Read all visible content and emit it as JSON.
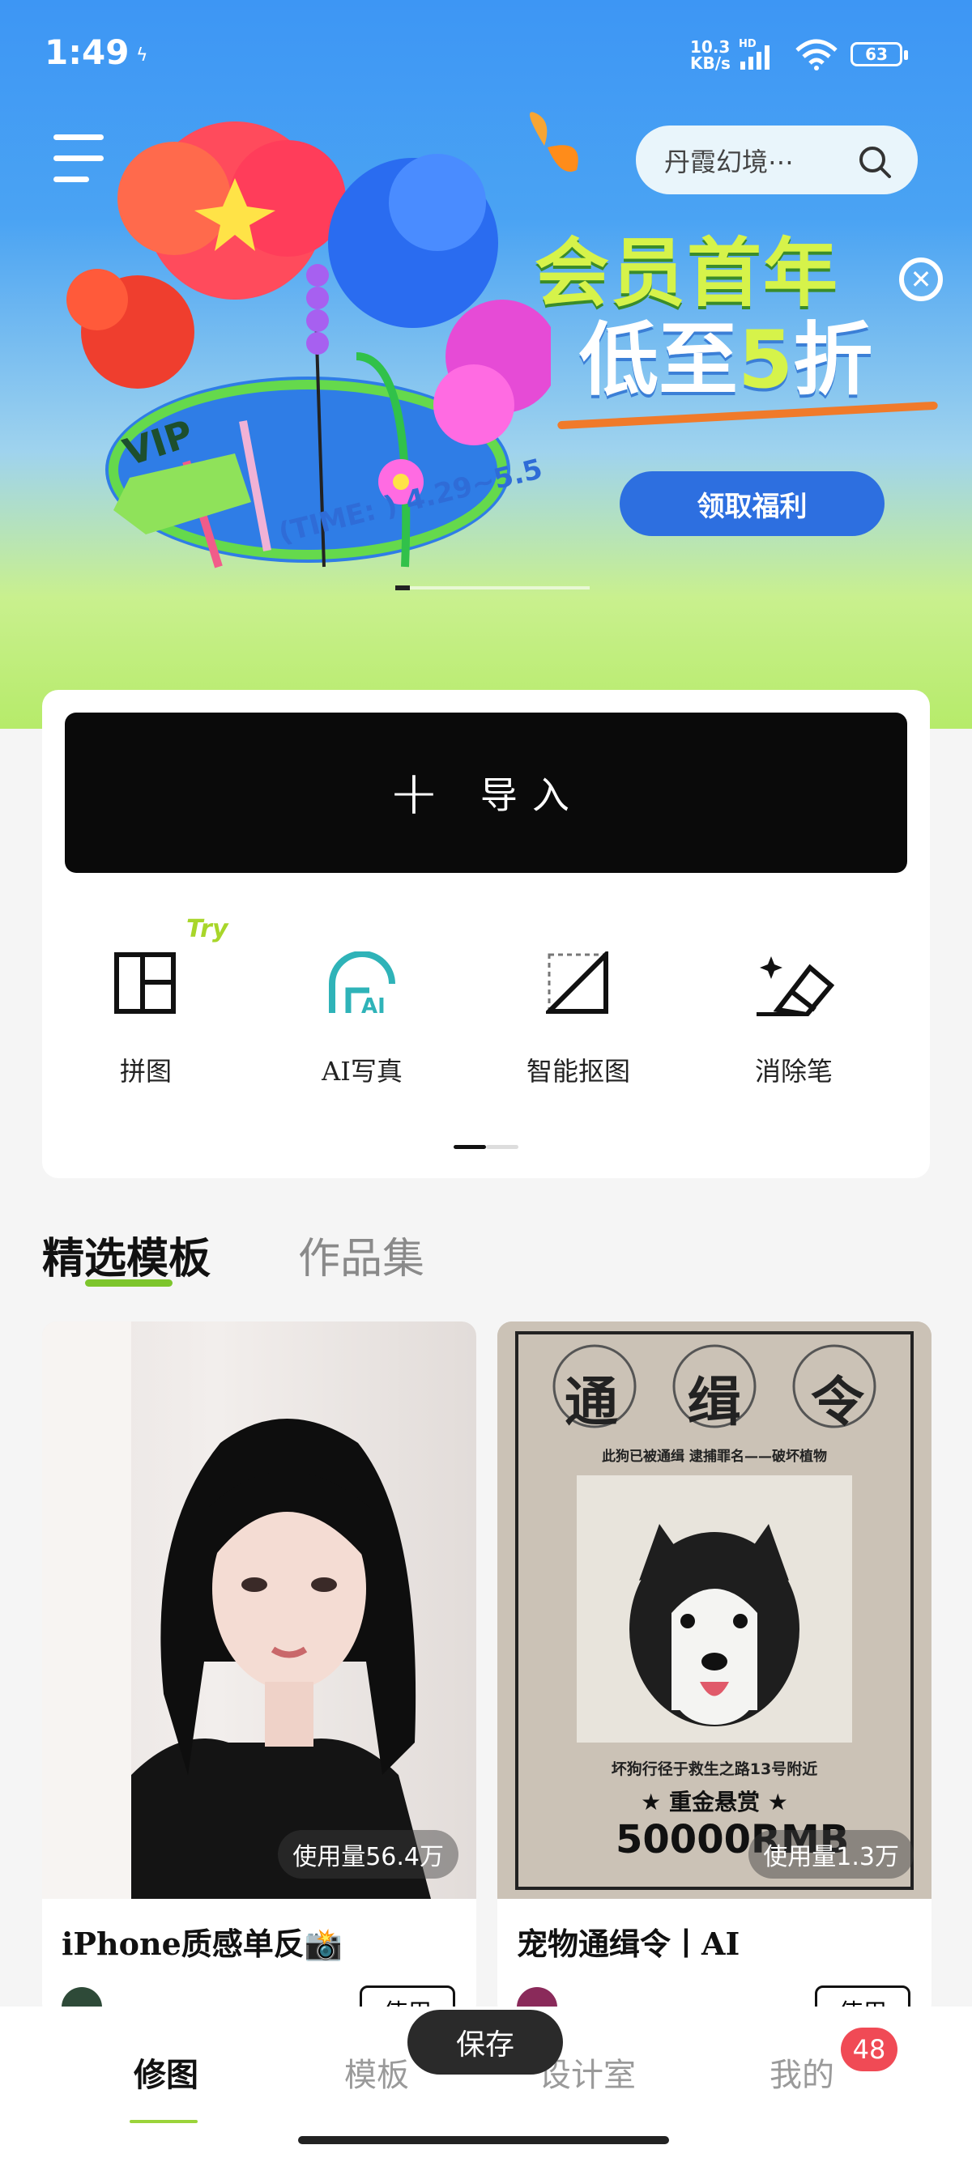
{
  "status_bar": {
    "time": "1:49",
    "net_speed": "10.3",
    "net_unit": "KB/s",
    "battery": "63"
  },
  "header": {
    "search_text": "丹霞幻境⋯"
  },
  "banner": {
    "title_line1": "会员首年",
    "title_line2_pre": "低至",
    "title_line2_num": "5",
    "title_line2_post": "折",
    "vip_label": "VIP",
    "date": "(TIME: ) 4.29~5.5",
    "button": "领取福利"
  },
  "card": {
    "import_plus": "+",
    "import_label": "导入",
    "try_label": "Try",
    "tools": [
      {
        "label": "拼图",
        "icon": "collage-icon"
      },
      {
        "label": "AI写真",
        "icon": "ai-portrait-icon"
      },
      {
        "label": "智能抠图",
        "icon": "smart-cutout-icon"
      },
      {
        "label": "消除笔",
        "icon": "eraser-icon"
      }
    ]
  },
  "tabs": {
    "active": "精选模板",
    "other": "作品集"
  },
  "templates": [
    {
      "title": "iPhone质感单反📸",
      "usage": "使用量56.4万",
      "use_button": "使用"
    },
    {
      "title": "宠物通缉令丨AI",
      "usage": "使用量1.3万",
      "use_button": "使用"
    }
  ],
  "poster": {
    "heading_1": "通",
    "heading_2": "缉",
    "heading_3": "令",
    "subtitle": "此狗已被通缉 逮捕罪名——破坏植物",
    "location": "坏狗行径于救生之路13号附近",
    "reward": "★ 重金悬赏 ★",
    "amount": "50000RMB"
  },
  "bottom_nav": {
    "items": [
      "修图",
      "模板",
      "设计室",
      "我的"
    ],
    "save": "保存",
    "badge": "48"
  },
  "colors": {
    "accent_green": "#7dc52c",
    "banner_blue": "#2d6fe0",
    "badge_red": "#f04a55"
  }
}
